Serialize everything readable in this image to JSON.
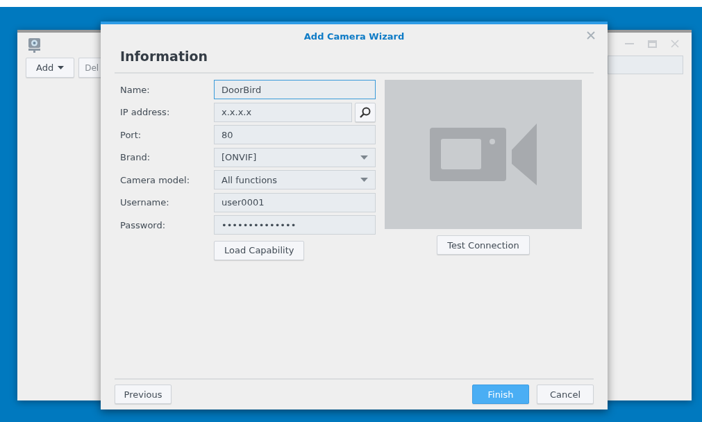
{
  "background_window": {
    "toolbar": [
      {
        "label": "Add",
        "kind": "dropdown"
      },
      {
        "label": "Del",
        "kind": "plain"
      }
    ]
  },
  "dialog": {
    "title": "Add Camera Wizard",
    "heading": "Information",
    "fields": [
      {
        "label": "Name:",
        "value": "DoorBird",
        "kind": "text",
        "focused": true
      },
      {
        "label": "IP address:",
        "value": "x.x.x.x",
        "kind": "search",
        "focused": false
      },
      {
        "label": "Port:",
        "value": "80",
        "kind": "text",
        "focused": false
      },
      {
        "label": "Brand:",
        "value": "[ONVIF]",
        "kind": "select",
        "focused": false
      },
      {
        "label": "Camera model:",
        "value": "All functions",
        "kind": "select",
        "focused": false
      },
      {
        "label": "Username:",
        "value": "user0001",
        "kind": "text",
        "focused": false
      },
      {
        "label": "Password:",
        "value": "••••••••••••••",
        "kind": "text",
        "focused": false
      }
    ],
    "load_button": "Load Capability",
    "test_button": "Test Connection",
    "footer": [
      {
        "label": "Previous",
        "kind": "secondary"
      },
      {
        "label": "Finish",
        "kind": "primary"
      },
      {
        "label": "Cancel",
        "kind": "secondary"
      }
    ]
  }
}
